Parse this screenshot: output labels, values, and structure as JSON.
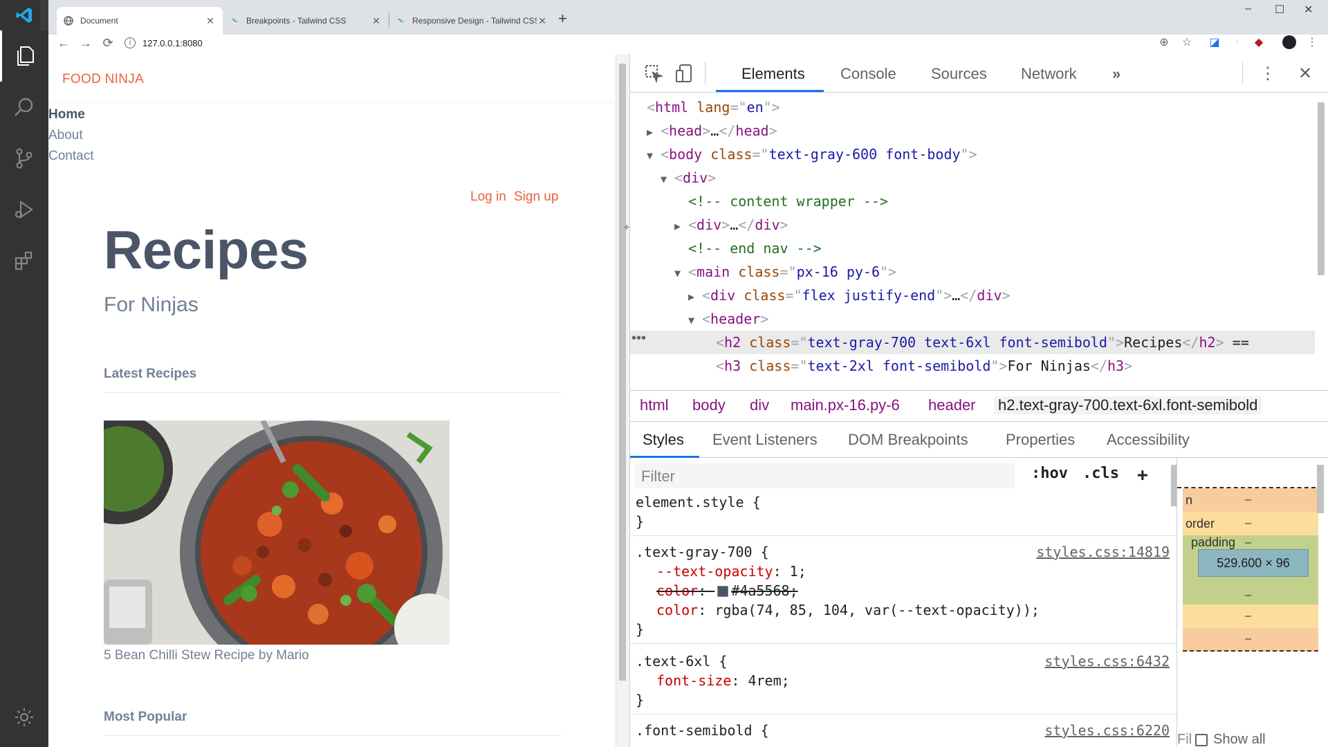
{
  "browser": {
    "tabs": [
      {
        "title": "Document",
        "active": true
      },
      {
        "title": "Breakpoints - Tailwind CSS",
        "active": false
      },
      {
        "title": "Responsive Design - Tailwind CSS",
        "active": false
      }
    ],
    "url": "127.0.0.1:8080"
  },
  "page": {
    "brand": "FOOD NINJA",
    "nav": [
      "Home",
      "About",
      "Contact"
    ],
    "auth": {
      "login": "Log in",
      "signup": "Sign up"
    },
    "title": "Recipes",
    "subtitle": "For Ninjas",
    "latest_heading": "Latest Recipes",
    "recipe_caption": "5 Bean Chilli Stew Recipe by Mario",
    "popular_heading": "Most Popular"
  },
  "devtools": {
    "tabs": [
      "Elements",
      "Console",
      "Sources",
      "Network"
    ],
    "more_tabs": "»",
    "dom": [
      {
        "indent": 0,
        "tri": "",
        "html": [
          [
            "pn",
            "<"
          ],
          [
            "tg",
            "html"
          ],
          [
            "tx",
            " "
          ],
          [
            "at",
            "lang"
          ],
          [
            "pn",
            "=\""
          ],
          [
            "av",
            "en"
          ],
          [
            "pn",
            "\">"
          ]
        ]
      },
      {
        "indent": 1,
        "tri": "right",
        "html": [
          [
            "pn",
            "<"
          ],
          [
            "tg",
            "head"
          ],
          [
            "pn",
            ">"
          ],
          [
            "tx",
            "…"
          ],
          [
            "pn",
            "</"
          ],
          [
            "tg",
            "head"
          ],
          [
            "pn",
            ">"
          ]
        ]
      },
      {
        "indent": 1,
        "tri": "down",
        "html": [
          [
            "pn",
            "<"
          ],
          [
            "tg",
            "body"
          ],
          [
            "tx",
            " "
          ],
          [
            "at",
            "class"
          ],
          [
            "pn",
            "=\""
          ],
          [
            "av",
            "text-gray-600 font-body"
          ],
          [
            "pn",
            "\">"
          ]
        ]
      },
      {
        "indent": 2,
        "tri": "down",
        "html": [
          [
            "pn",
            "<"
          ],
          [
            "tg",
            "div"
          ],
          [
            "pn",
            ">"
          ]
        ]
      },
      {
        "indent": 3,
        "tri": "",
        "html": [
          [
            "cm",
            "<!-- content wrapper -->"
          ]
        ]
      },
      {
        "indent": 3,
        "tri": "right",
        "html": [
          [
            "pn",
            "<"
          ],
          [
            "tg",
            "div"
          ],
          [
            "pn",
            ">"
          ],
          [
            "tx",
            "…"
          ],
          [
            "pn",
            "</"
          ],
          [
            "tg",
            "div"
          ],
          [
            "pn",
            ">"
          ]
        ]
      },
      {
        "indent": 3,
        "tri": "",
        "html": [
          [
            "cm",
            "<!-- end nav -->"
          ]
        ]
      },
      {
        "indent": 3,
        "tri": "down",
        "html": [
          [
            "pn",
            "<"
          ],
          [
            "tg",
            "main"
          ],
          [
            "tx",
            " "
          ],
          [
            "at",
            "class"
          ],
          [
            "pn",
            "=\""
          ],
          [
            "av",
            "px-16 py-6"
          ],
          [
            "pn",
            "\">"
          ]
        ]
      },
      {
        "indent": 4,
        "tri": "right",
        "html": [
          [
            "pn",
            "<"
          ],
          [
            "tg",
            "div"
          ],
          [
            "tx",
            " "
          ],
          [
            "at",
            "class"
          ],
          [
            "pn",
            "=\""
          ],
          [
            "av",
            "flex justify-end"
          ],
          [
            "pn",
            "\">"
          ],
          [
            "tx",
            "…"
          ],
          [
            "pn",
            "</"
          ],
          [
            "tg",
            "div"
          ],
          [
            "pn",
            ">"
          ]
        ]
      },
      {
        "indent": 4,
        "tri": "down",
        "html": [
          [
            "pn",
            "<"
          ],
          [
            "tg",
            "header"
          ],
          [
            "pn",
            ">"
          ]
        ]
      },
      {
        "indent": 5,
        "tri": "",
        "selected": true,
        "html": [
          [
            "pn",
            "<"
          ],
          [
            "tg",
            "h2"
          ],
          [
            "tx",
            " "
          ],
          [
            "at",
            "class"
          ],
          [
            "pn",
            "=\""
          ],
          [
            "av",
            "text-gray-700 text-6xl font-semibold"
          ],
          [
            "pn",
            "\">"
          ],
          [
            "tx",
            "Recipes"
          ],
          [
            "pn",
            "</"
          ],
          [
            "tg",
            "h2"
          ],
          [
            "pn",
            ">"
          ],
          [
            "tx",
            " =="
          ]
        ]
      },
      {
        "indent": 5,
        "tri": "",
        "html": [
          [
            "pn",
            "<"
          ],
          [
            "tg",
            "h3"
          ],
          [
            "tx",
            " "
          ],
          [
            "at",
            "class"
          ],
          [
            "pn",
            "=\""
          ],
          [
            "av",
            "text-2xl font-semibold"
          ],
          [
            "pn",
            "\">"
          ],
          [
            "tx",
            "For Ninjas"
          ],
          [
            "pn",
            "</"
          ],
          [
            "tg",
            "h3"
          ],
          [
            "pn",
            ">"
          ]
        ]
      }
    ],
    "breadcrumbs": [
      "html",
      "body",
      "div",
      "main.px-16.py-6",
      "header",
      "h2.text-gray-700.text-6xl.font-semibold"
    ],
    "subtabs": [
      "Styles",
      "Event Listeners",
      "DOM Breakpoints",
      "Properties",
      "Accessibility"
    ],
    "filter_placeholder": "Filter",
    "hov": ":hov",
    "cls": ".cls",
    "plus": "+",
    "styles": {
      "element_style": "element.style {",
      "close": "}",
      "rule1_selector": ".text-gray-700 {",
      "rule1_src": "styles.css:14819",
      "rule1_prop1": "--text-opacity",
      "rule1_val1": "1;",
      "rule1_prop2": "color",
      "rule1_val2": "#4a5568;",
      "rule1_prop3": "color",
      "rule1_val3": "rgba(74, 85, 104, var(--text-opacity));",
      "rule2_selector": ".text-6xl {",
      "rule2_src": "styles.css:6432",
      "rule2_prop1": "font-size",
      "rule2_val1": "4rem;",
      "rule3_selector": ".font-semibold {",
      "rule3_src": "styles.css:6220"
    },
    "boxmodel": {
      "margin_label": "n",
      "border_label": "order",
      "padding_label": "padding",
      "dash": "–",
      "content_size": "529.600 × 96",
      "filter_short": "Fil",
      "show_all": "Show all"
    }
  },
  "colors": {
    "accent": "#e8613b",
    "devtools_blue": "#1a73e8",
    "margin_box": "#f9cc9d",
    "border_box": "#fddd9b",
    "padding_box": "#c3d08b",
    "content_box": "#8cb6c0"
  }
}
